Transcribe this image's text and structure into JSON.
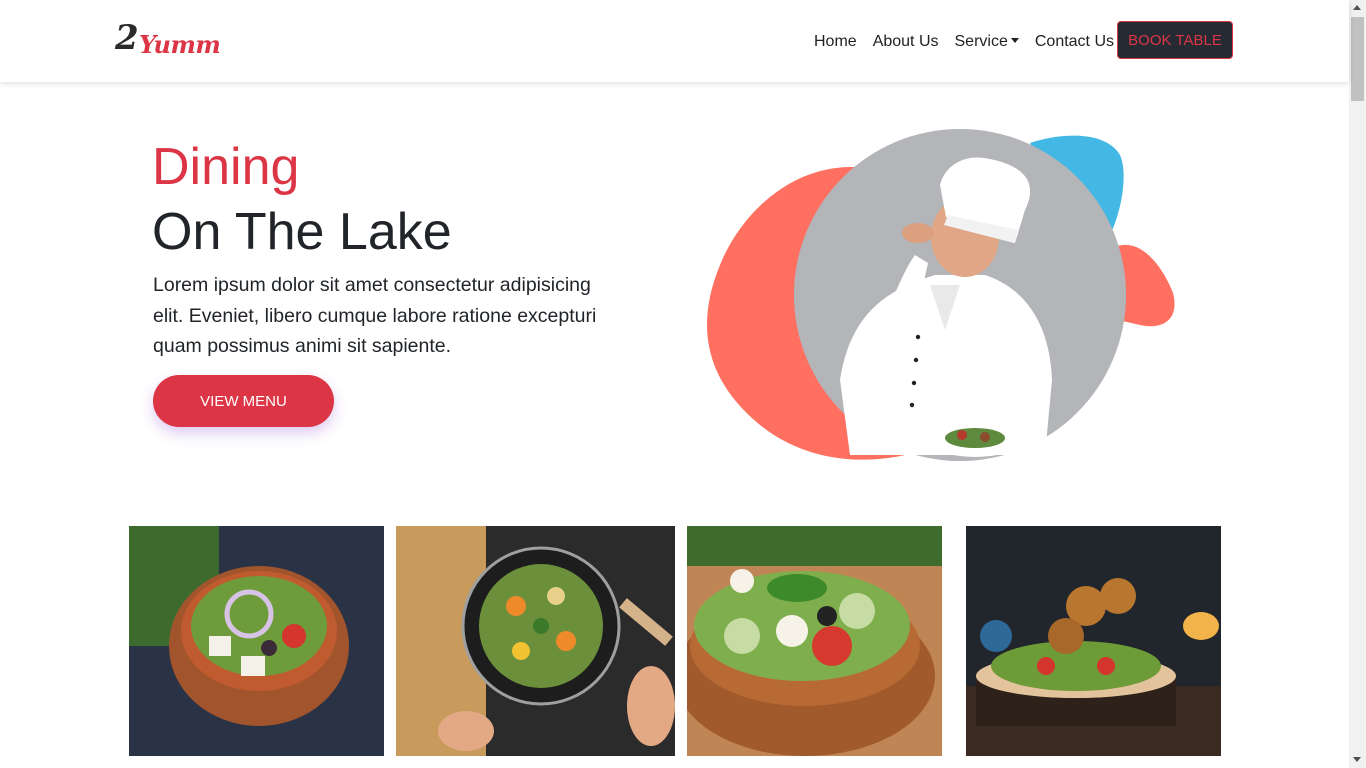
{
  "brand": {
    "number": "2",
    "word": "Yumm"
  },
  "nav": {
    "items": [
      {
        "label": "Home"
      },
      {
        "label": "About Us"
      },
      {
        "label": "Service"
      },
      {
        "label": "Contact Us"
      }
    ],
    "book_button": "BOOK TABLE"
  },
  "hero": {
    "title_accent": "Dining",
    "title_main": "On The Lake",
    "text": "Lorem ipsum dolor sit amet consectetur adipisicing elit. Eveniet, libero cumque labore ratione excepturi quam possimus animi sit sapiente.",
    "button": "VIEW MENU"
  },
  "colors": {
    "accent": "#dc3545",
    "dark": "#212529",
    "blob_coral": "#ff7061",
    "blob_blue": "#44b8e4"
  },
  "icons": [
    "dropdown-caret-icon",
    "scroll-up-icon",
    "scroll-down-icon"
  ]
}
